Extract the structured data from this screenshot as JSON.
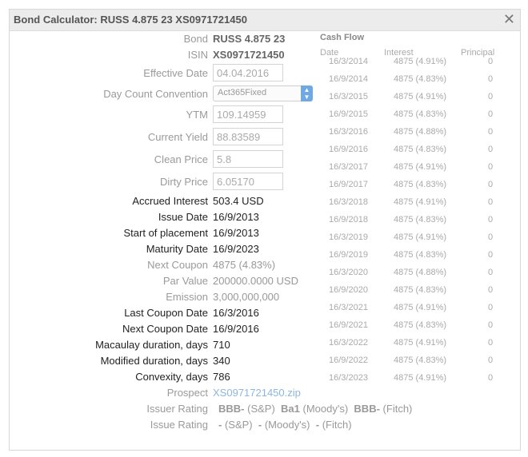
{
  "window": {
    "title": "Bond Calculator: RUSS 4.875 23 XS0971721450",
    "close_glyph": "✕"
  },
  "form": {
    "bond_label": "Bond",
    "bond_value": "RUSS 4.875 23",
    "isin_label": "ISIN",
    "isin_value": "XS0971721450",
    "effective_date_label": "Effective Date",
    "effective_date_value": "04.04.2016",
    "day_count_label": "Day Count Convention",
    "day_count_value": "Act365Fixed",
    "ytm_label": "YTM",
    "ytm_value": "109.14959",
    "current_yield_label": "Current Yield",
    "current_yield_value": "88.83589",
    "clean_price_label": "Clean Price",
    "clean_price_value": "5.8",
    "dirty_price_label": "Dirty Price",
    "dirty_price_value": "6.05170",
    "accrued_interest_label": "Accrued Interest",
    "accrued_interest_value": "503.4 USD",
    "issue_date_label": "Issue Date",
    "issue_date_value": "16/9/2013",
    "start_placement_label": "Start of placement",
    "start_placement_value": "16/9/2013",
    "maturity_date_label": "Maturity Date",
    "maturity_date_value": "16/9/2023",
    "next_coupon_label": "Next Coupon",
    "next_coupon_value": "4875 (4.83%)",
    "par_value_label": "Par Value",
    "par_value_value": "200000.0000 USD",
    "emission_label": "Emission",
    "emission_value": "3,000,000,000",
    "last_coupon_date_label": "Last Coupon Date",
    "last_coupon_date_value": "16/3/2016",
    "next_coupon_date_label": "Next Coupon Date",
    "next_coupon_date_value": "16/9/2016",
    "macaulay_label": "Macaulay duration, days",
    "macaulay_value": "710",
    "modified_label": "Modified duration, days",
    "modified_value": "340",
    "convexity_label": "Convexity, days",
    "convexity_value": "786",
    "prospect_label": "Prospect",
    "prospect_value": "XS0971721450.zip",
    "issuer_rating_label": "Issuer Rating",
    "issuer_rating": {
      "sp": "BBB-",
      "sp_agency": "(S&P)",
      "moodys": "Ba1",
      "moodys_agency": "(Moody's)",
      "fitch": "BBB-",
      "fitch_agency": "(Fitch)"
    },
    "issue_rating_label": "Issue Rating",
    "issue_rating": {
      "sp": "-",
      "sp_agency": "(S&P)",
      "moodys": "-",
      "moodys_agency": "(Moody's)",
      "fitch": "-",
      "fitch_agency": "(Fitch)"
    }
  },
  "cash_flow": {
    "title": "Cash Flow",
    "headers": {
      "date": "Date",
      "interest": "Interest",
      "principal": "Principal"
    },
    "rows": [
      {
        "date": "16/3/2014",
        "interest": "4875 (4.91%)",
        "principal": "0"
      },
      {
        "date": "16/9/2014",
        "interest": "4875 (4.83%)",
        "principal": "0"
      },
      {
        "date": "16/3/2015",
        "interest": "4875 (4.91%)",
        "principal": "0"
      },
      {
        "date": "16/9/2015",
        "interest": "4875 (4.83%)",
        "principal": "0"
      },
      {
        "date": "16/3/2016",
        "interest": "4875 (4.88%)",
        "principal": "0"
      },
      {
        "date": "16/9/2016",
        "interest": "4875 (4.83%)",
        "principal": "0"
      },
      {
        "date": "16/3/2017",
        "interest": "4875 (4.91%)",
        "principal": "0"
      },
      {
        "date": "16/9/2017",
        "interest": "4875 (4.83%)",
        "principal": "0"
      },
      {
        "date": "16/3/2018",
        "interest": "4875 (4.91%)",
        "principal": "0"
      },
      {
        "date": "16/9/2018",
        "interest": "4875 (4.83%)",
        "principal": "0"
      },
      {
        "date": "16/3/2019",
        "interest": "4875 (4.91%)",
        "principal": "0"
      },
      {
        "date": "16/9/2019",
        "interest": "4875 (4.83%)",
        "principal": "0"
      },
      {
        "date": "16/3/2020",
        "interest": "4875 (4.88%)",
        "principal": "0"
      },
      {
        "date": "16/9/2020",
        "interest": "4875 (4.83%)",
        "principal": "0"
      },
      {
        "date": "16/3/2021",
        "interest": "4875 (4.91%)",
        "principal": "0"
      },
      {
        "date": "16/9/2021",
        "interest": "4875 (4.83%)",
        "principal": "0"
      },
      {
        "date": "16/3/2022",
        "interest": "4875 (4.91%)",
        "principal": "0"
      },
      {
        "date": "16/9/2022",
        "interest": "4875 (4.83%)",
        "principal": "0"
      },
      {
        "date": "16/3/2023",
        "interest": "4875 (4.91%)",
        "principal": "0"
      }
    ]
  },
  "colors": {
    "link": "#8db6e3",
    "select_button": "#6ea9e6",
    "titlebar": "#ececec"
  }
}
